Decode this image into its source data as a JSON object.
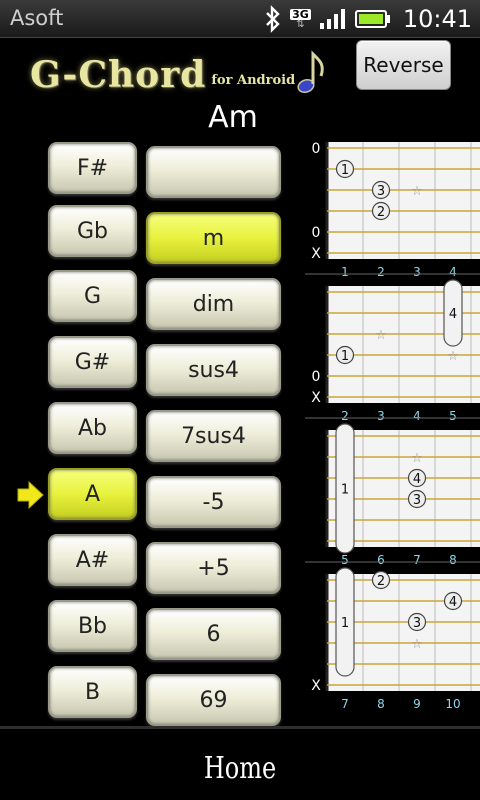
{
  "status_bar": {
    "app_name": "Asoft",
    "network": "3G",
    "time": "10:41"
  },
  "header": {
    "logo_title": "G-Chord",
    "logo_subtitle": "for Android",
    "reverse_label": "Reverse"
  },
  "chord_name": "Am",
  "keys": [
    {
      "label": "F#",
      "selected": false
    },
    {
      "label": "Gb",
      "selected": false
    },
    {
      "label": "G",
      "selected": false
    },
    {
      "label": "G#",
      "selected": false
    },
    {
      "label": "Ab",
      "selected": false
    },
    {
      "label": "A",
      "selected": true
    },
    {
      "label": "A#",
      "selected": false
    },
    {
      "label": "Bb",
      "selected": false
    },
    {
      "label": "B",
      "selected": false
    }
  ],
  "chord_types": [
    {
      "label": "",
      "selected": false
    },
    {
      "label": "m",
      "selected": true
    },
    {
      "label": "dim",
      "selected": false
    },
    {
      "label": "sus4",
      "selected": false
    },
    {
      "label": "7sus4",
      "selected": false
    },
    {
      "label": "-5",
      "selected": false
    },
    {
      "label": "+5",
      "selected": false
    },
    {
      "label": "6",
      "selected": false
    },
    {
      "label": "69",
      "selected": false
    }
  ],
  "diagrams": [
    {
      "frets": [
        "1",
        "2",
        "3",
        "4"
      ],
      "string_marks": [
        {
          "string": 1,
          "text": "0"
        },
        {
          "string": 5,
          "text": "0"
        },
        {
          "string": 6,
          "text": "X"
        }
      ],
      "dots": [
        {
          "string": 2,
          "fret": 1,
          "finger": "1"
        },
        {
          "string": 3,
          "fret": 2,
          "finger": "3"
        },
        {
          "string": 4,
          "fret": 2,
          "finger": "2"
        }
      ],
      "stars": [
        {
          "string": 3,
          "fret": 3
        }
      ],
      "barres": []
    },
    {
      "frets": [
        "2",
        "3",
        "4",
        "5"
      ],
      "string_marks": [
        {
          "string": 5,
          "text": "0"
        },
        {
          "string": 6,
          "text": "X"
        }
      ],
      "dots": [
        {
          "string": 4,
          "fret": 1,
          "finger": "1"
        }
      ],
      "stars": [
        {
          "string": 3,
          "fret": 2
        },
        {
          "string": 4,
          "fret": 4
        }
      ],
      "barres": [
        {
          "fret": 4,
          "from": 1,
          "to": 3,
          "finger": "4"
        }
      ]
    },
    {
      "frets": [
        "5",
        "6",
        "7",
        "8"
      ],
      "string_marks": [],
      "dots": [
        {
          "string": 3,
          "fret": 3,
          "finger": "4"
        },
        {
          "string": 4,
          "fret": 3,
          "finger": "3"
        }
      ],
      "stars": [
        {
          "string": 2,
          "fret": 3
        }
      ],
      "barres": [
        {
          "fret": 1,
          "from": 1,
          "to": 6,
          "finger": "1"
        }
      ]
    },
    {
      "frets": [
        "7",
        "8",
        "9",
        "10"
      ],
      "string_marks": [
        {
          "string": 6,
          "text": "X"
        }
      ],
      "dots": [
        {
          "string": 1,
          "fret": 2,
          "finger": "2"
        },
        {
          "string": 2,
          "fret": 4,
          "finger": "4"
        },
        {
          "string": 3,
          "fret": 3,
          "finger": "3"
        }
      ],
      "stars": [
        {
          "string": 4,
          "fret": 3
        }
      ],
      "barres": [
        {
          "fret": 1,
          "from": 1,
          "to": 5,
          "finger": "1"
        }
      ]
    }
  ],
  "bottom_nav": {
    "home_label": "Home"
  },
  "colors": {
    "selected": "#e8f23d",
    "logo": "#e8e6a0",
    "fret_line": "#c9a53a"
  }
}
